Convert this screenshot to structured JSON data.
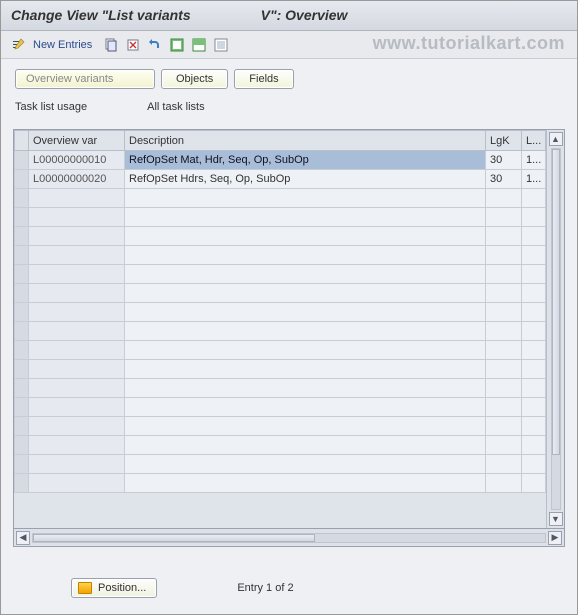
{
  "title": "Change View \"List variants                  V\": Overview",
  "toolbar": {
    "new_entries": "New Entries"
  },
  "watermark": "www.tutorialkart.com",
  "tabs": {
    "overview": "Overview variants",
    "objects": "Objects",
    "fields": "Fields"
  },
  "filter": {
    "label": "Task list usage",
    "value": "All task lists"
  },
  "table": {
    "headers": {
      "overview_var": "Overview var",
      "description": "Description",
      "lgk": "LgK",
      "l": "L..."
    },
    "rows": [
      {
        "var": "L00000000010",
        "desc": "RefOpSet Mat, Hdr, Seq, Op, SubOp",
        "lgk": "30",
        "l": "1...",
        "selected": true
      },
      {
        "var": "L00000000020",
        "desc": "RefOpSet Hdrs, Seq, Op, SubOp",
        "lgk": "30",
        "l": "1...",
        "selected": false
      }
    ],
    "empty_rows": 16
  },
  "footer": {
    "position_label": "Position...",
    "entry_text": "Entry 1 of 2"
  }
}
